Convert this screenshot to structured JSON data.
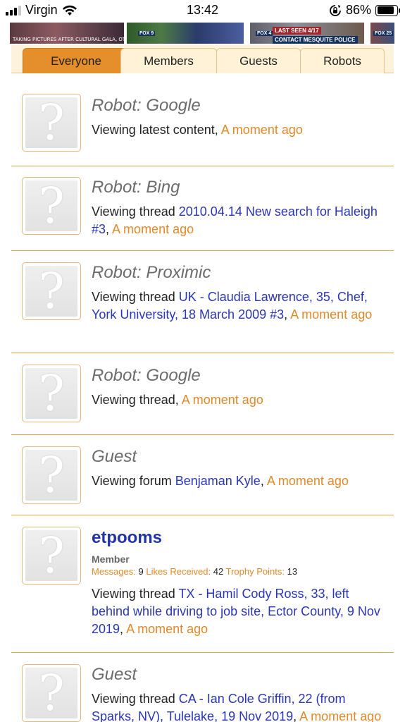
{
  "status_bar": {
    "carrier": "Virgin",
    "time": "13:42",
    "battery": "86%",
    "battery_level": 0.86
  },
  "banner": {
    "thumbs": [
      {
        "label": "TAKING PICTURES AFTER CULTURAL GALA, OTHER MEMBERS..."
      },
      {
        "badge": "FOX 9"
      },
      {
        "badge": "FOX 4",
        "caption": "LAST SEEN 4/17"
      },
      {
        "caption": "CONTACT MESQUITE POLICE"
      },
      {
        "badge": "FOX 25"
      }
    ]
  },
  "tabs": [
    {
      "label": "Everyone",
      "active": true
    },
    {
      "label": "Members",
      "active": false
    },
    {
      "label": "Guests",
      "active": false
    },
    {
      "label": "Robots",
      "active": false
    }
  ],
  "avatar_glyph": "?",
  "entries": [
    {
      "name": "Robot: Google",
      "action": "Viewing latest content",
      "sep": ", ",
      "time": "A moment ago"
    },
    {
      "name": "Robot: Bing",
      "action": "Viewing thread ",
      "link": "2010.04.14 New search for Haleigh #3",
      "sep": ", ",
      "time": "A moment ago"
    },
    {
      "name": "Robot: Proximic",
      "action": "Viewing thread ",
      "link": "UK - Claudia Lawrence, 35, Chef, York University, 18 March 2009 #3",
      "sep": ", ",
      "time": "A moment ago"
    },
    {
      "name": "Robot: Google",
      "action": "Viewing thread",
      "sep": ", ",
      "time": "A moment ago"
    },
    {
      "name": "Guest",
      "action": "Viewing forum ",
      "link": "Benjaman Kyle",
      "sep": ", ",
      "time": "A moment ago"
    },
    {
      "name": "etpooms",
      "user_title": "Member",
      "stats": {
        "messages_label": "Messages:",
        "messages": "9",
        "likes_label": "Likes Received:",
        "likes": "42",
        "trophy_label": "Trophy Points:",
        "trophy": "13"
      },
      "action": "Viewing thread ",
      "link": "TX - Hamil Cody Ross, 33, left behind while driving to job site, Ector County, 9 Nov 2019",
      "sep": ", ",
      "time": "A moment ago"
    },
    {
      "name": "Guest",
      "action": "Viewing thread ",
      "link": "CA - Ian Cole Griffin, 22 (from Sparks, NV), Tulelake, 19 Nov 2019",
      "sep": ", ",
      "time": "A moment ago"
    }
  ]
}
